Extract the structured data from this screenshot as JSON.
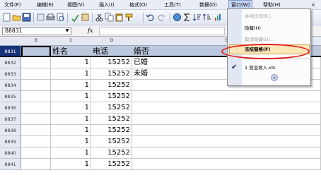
{
  "menubar": {
    "items": [
      {
        "label": "文件(F)"
      },
      {
        "label": "编辑(E)"
      },
      {
        "label": "视图(V)"
      },
      {
        "label": "插入(I)"
      },
      {
        "label": "格式(O)"
      },
      {
        "label": "工具(T)"
      },
      {
        "label": "数据(D)"
      },
      {
        "label": "窗口(W)"
      },
      {
        "label": "帮助(H)"
      }
    ],
    "close": "×"
  },
  "namebox": {
    "value": "B8831",
    "arrow": "▼"
  },
  "formula": {
    "fx": "fx",
    "value": ""
  },
  "columns": [
    "B",
    "C",
    "D",
    "E"
  ],
  "rows": [
    {
      "num": "8831",
      "c": "姓名",
      "d": "电话",
      "e": "婚否",
      "header": true
    },
    {
      "num": "8832",
      "c": "1",
      "d": "15252",
      "e": "已婚"
    },
    {
      "num": "8833",
      "c": "1",
      "d": "15252",
      "e": "未婚"
    },
    {
      "num": "8834",
      "c": "1",
      "d": "15252",
      "e": ""
    },
    {
      "num": "8835",
      "c": "1",
      "d": "15252",
      "e": ""
    },
    {
      "num": "8836",
      "c": "1",
      "d": "15252",
      "e": ""
    },
    {
      "num": "8837",
      "c": "1",
      "d": "15252",
      "e": ""
    },
    {
      "num": "8838",
      "c": "1",
      "d": "15252",
      "e": ""
    },
    {
      "num": "8839",
      "c": "1",
      "d": "15252",
      "e": ""
    },
    {
      "num": "8840",
      "c": "1",
      "d": "15252",
      "e": ""
    },
    {
      "num": "8841",
      "c": "1",
      "d": "15252",
      "e": ""
    }
  ],
  "window_menu": {
    "items": [
      {
        "label": "并排比较(B)...",
        "disabled": true
      },
      {
        "label": "隐藏(H)",
        "disabled": false
      },
      {
        "label": "取消隐藏(U)...",
        "disabled": true
      },
      {
        "label": "冻结窗格(F)",
        "disabled": false,
        "highlighted": true
      },
      {
        "label": "1 营业收入.xls",
        "checked": true
      }
    ],
    "expand": "»"
  },
  "colors": {
    "accent": "#e01b1b",
    "menu_highlight": "#fbe6b8",
    "selected_row_header": "#16337b"
  }
}
